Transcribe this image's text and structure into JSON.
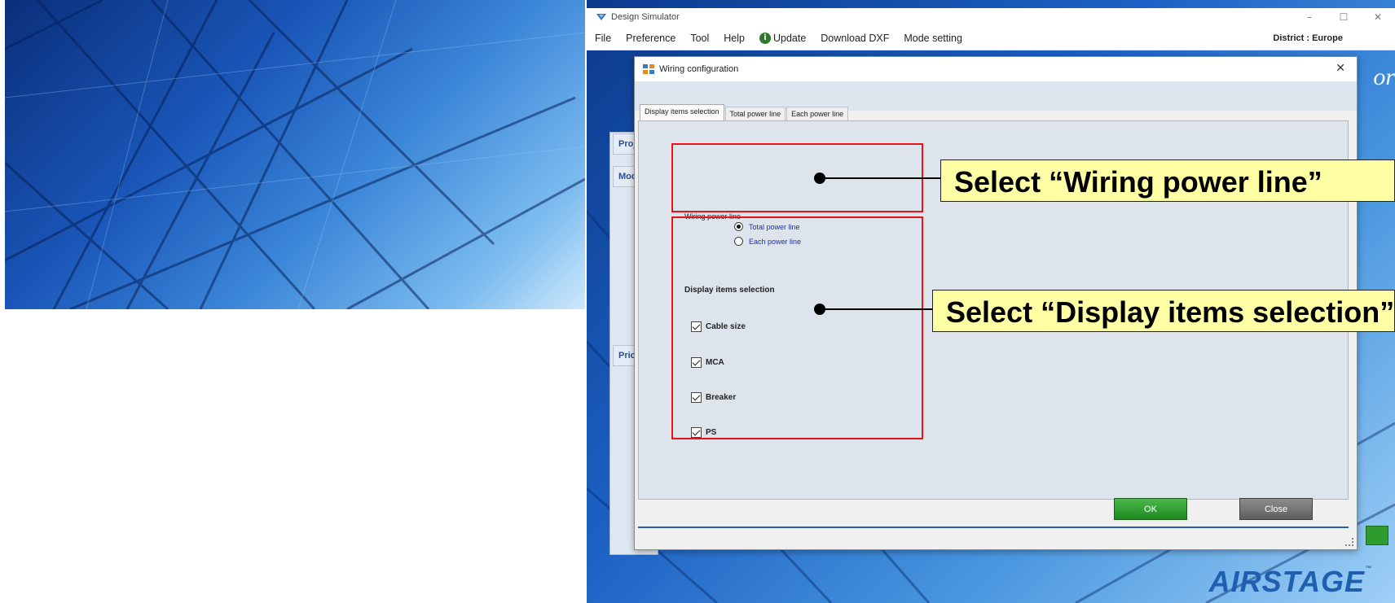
{
  "app": {
    "title": "Design Simulator",
    "window_controls": [
      "–",
      "☐",
      "✕"
    ],
    "menu": [
      {
        "label": "File"
      },
      {
        "label": "Preference"
      },
      {
        "label": "Tool"
      },
      {
        "label": "Help"
      },
      {
        "label": "Update",
        "icon": "info-icon"
      },
      {
        "label": "Download DXF"
      },
      {
        "label": "Mode setting"
      }
    ],
    "district": "District : Europe",
    "brand_fragment": "or",
    "side_tabs": [
      "Proj",
      "Mod",
      "Pric"
    ],
    "logo_text": "AIRSTAGE",
    "logo_tm": "™"
  },
  "dialog": {
    "title": "Wiring configuration",
    "close_glyph": "✕",
    "tabs": [
      {
        "label": "Display items selection",
        "active": true
      },
      {
        "label": "Total power line",
        "active": false
      },
      {
        "label": "Each power line",
        "active": false
      }
    ],
    "wiring_power_line": {
      "label": "Wiring power line",
      "options": [
        {
          "label": "Total power line",
          "selected": true
        },
        {
          "label": "Each power line",
          "selected": false
        }
      ]
    },
    "display_items": {
      "title": "Display items selection",
      "items": [
        {
          "label": "Cable size",
          "checked": true
        },
        {
          "label": "MCA",
          "checked": true
        },
        {
          "label": "Breaker",
          "checked": true
        },
        {
          "label": "PS",
          "checked": true
        }
      ]
    },
    "ok_label": "OK",
    "close_label": "Close"
  },
  "annotations": {
    "callout_1": "Select “Wiring power line”",
    "callout_2": "Select “Display items selection”",
    "highlight_color": "#e8121b",
    "callout_bg": "#ffffa6"
  }
}
